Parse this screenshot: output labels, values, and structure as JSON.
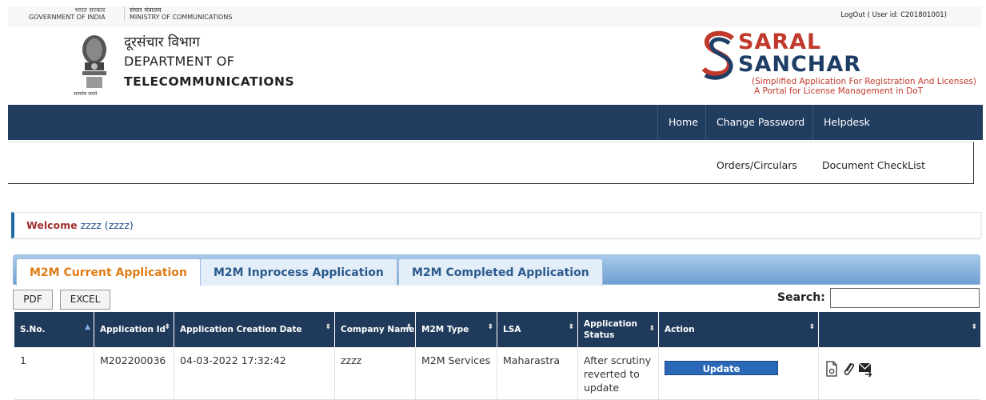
{
  "topbar": {
    "gov_hindi": "भारत सरकार",
    "gov_english": "GOVERNMENT OF INDIA",
    "ministry_hindi": "संचार मंत्रालय",
    "ministry_english": "MINISTRY OF COMMUNICATIONS",
    "logout_text": "LogOut ( User id: C201801001)"
  },
  "header": {
    "emblem_caption": "सत्यमेव जयते",
    "dept_hindi": "दूरसंचार विभाग",
    "dept_line1": "DEPARTMENT OF",
    "dept_line2": "TELECOMMUNICATIONS",
    "brand_top": "SARAL",
    "brand_bottom": "SANCHAR",
    "brand_sub1": "(Simplified Application For Registration And Licenses)",
    "brand_sub2": "A Portal for License Management in DoT"
  },
  "nav": {
    "items": [
      "Home",
      "Change Password",
      "Helpdesk"
    ]
  },
  "subnav": {
    "items": [
      "Orders/Circulars",
      "Document CheckList"
    ]
  },
  "welcome": {
    "label": "Welcome",
    "user": "zzzz (zzzz)"
  },
  "tabs": [
    {
      "label": "M2M Current Application",
      "active": true
    },
    {
      "label": "M2M Inprocess Application",
      "active": false
    },
    {
      "label": "M2M Completed Application",
      "active": false
    }
  ],
  "toolbar": {
    "pdf_label": "PDF",
    "excel_label": "EXCEL",
    "search_label": "Search:",
    "search_value": ""
  },
  "table": {
    "headers": [
      "S.No.",
      "Application Id",
      "Application Creation Date",
      "Company Name",
      "M2M Type",
      "LSA",
      "Application Status",
      "Action",
      ""
    ],
    "rows": [
      {
        "sno": "1",
        "app_id": "M202200036",
        "date": "04-03-2022 17:32:42",
        "company": "zzzz",
        "type": "M2M Services",
        "lsa": "Maharastra",
        "status": "After scrutiny reverted to update",
        "action_label": "Update"
      }
    ]
  },
  "icons": [
    "document-icon",
    "paperclip-icon",
    "mail-forward-icon"
  ]
}
